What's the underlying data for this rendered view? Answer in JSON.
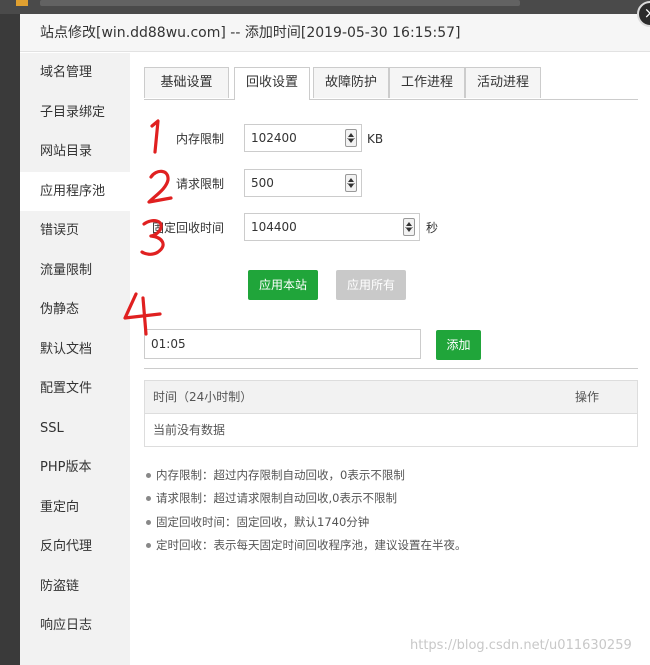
{
  "dialog": {
    "title": "站点修改[win.dd88wu.com] -- 添加时间[2019-05-30 16:15:57]",
    "close_glyph": "×"
  },
  "sidebar": {
    "items": [
      {
        "label": "域名管理"
      },
      {
        "label": "子目录绑定"
      },
      {
        "label": "网站目录"
      },
      {
        "label": "应用程序池",
        "active": true
      },
      {
        "label": "错误页"
      },
      {
        "label": "流量限制"
      },
      {
        "label": "伪静态"
      },
      {
        "label": "默认文档"
      },
      {
        "label": "配置文件"
      },
      {
        "label": "SSL"
      },
      {
        "label": "PHP版本"
      },
      {
        "label": "重定向"
      },
      {
        "label": "反向代理"
      },
      {
        "label": "防盗链"
      },
      {
        "label": "响应日志"
      }
    ]
  },
  "tabs": [
    {
      "label": "基础设置"
    },
    {
      "label": "回收设置",
      "active": true
    },
    {
      "label": "故障防护"
    },
    {
      "label": "工作进程"
    },
    {
      "label": "活动进程"
    }
  ],
  "form": {
    "memory_limit": {
      "label": "内存限制",
      "value": "102400",
      "unit": "KB"
    },
    "request_limit": {
      "label": "请求限制",
      "value": "500"
    },
    "fixed_recycle": {
      "label": "固定回收时间",
      "value": "104400",
      "unit": "秒"
    },
    "apply_site_label": "应用本站",
    "apply_all_label": "应用所有"
  },
  "schedule": {
    "time_value": "01:05",
    "add_label": "添加"
  },
  "table": {
    "headers": [
      "时间（24小时制）",
      "操作"
    ],
    "empty_text": "当前没有数据"
  },
  "notes": [
    "内存限制：超过内存限制自动回收，0表示不限制",
    "请求限制：超过请求限制自动回收,0表示不限制",
    "固定回收时间：固定回收，默认1740分钟",
    "定时回收：表示每天固定时间回收程序池，建议设置在半夜。"
  ],
  "annotations": {
    "color": "#e02020",
    "marks": [
      "1",
      "2",
      "3",
      "4"
    ]
  },
  "watermark": "https://blog.csdn.net/u011630259"
}
